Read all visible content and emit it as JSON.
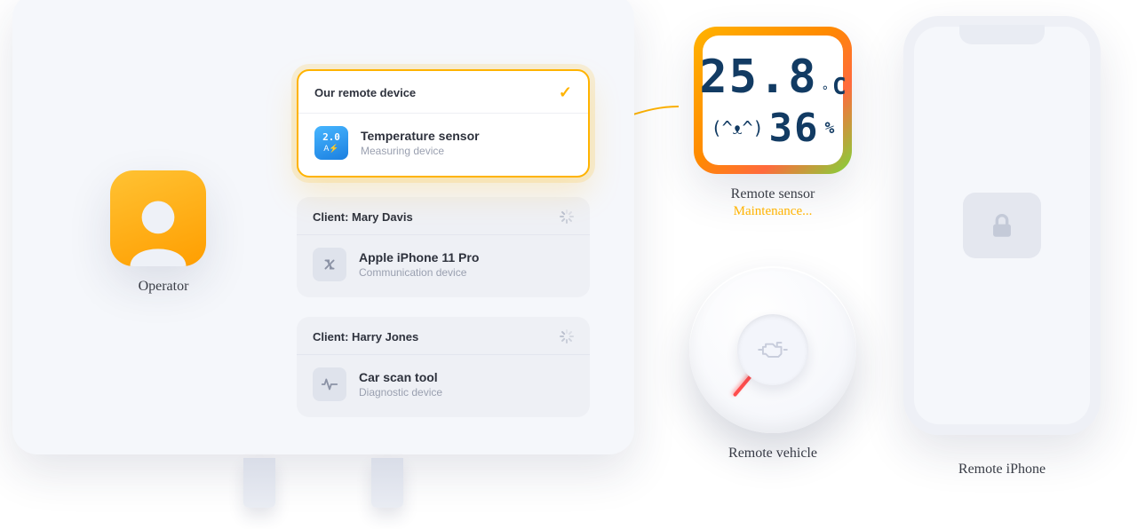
{
  "operator": {
    "label": "Operator"
  },
  "cards": {
    "active": {
      "header": "Our remote device",
      "title": "Temperature sensor",
      "sub": "Measuring device"
    },
    "mary": {
      "header": "Client: Mary Davis",
      "title": "Apple iPhone 11 Pro",
      "sub": "Communication device"
    },
    "harry": {
      "header": "Client: Harry Jones",
      "title": "Car scan tool",
      "sub": "Diagnostic device"
    }
  },
  "sensor": {
    "temperature": "25.8",
    "temp_degree": "°",
    "temp_unit": "C",
    "face": "(^ᴥ^)",
    "humidity": "36",
    "humidity_unit": "%",
    "label": "Remote sensor",
    "status": "Maintenance..."
  },
  "vehicle": {
    "label": "Remote vehicle"
  },
  "iphone": {
    "label": "Remote iPhone"
  }
}
